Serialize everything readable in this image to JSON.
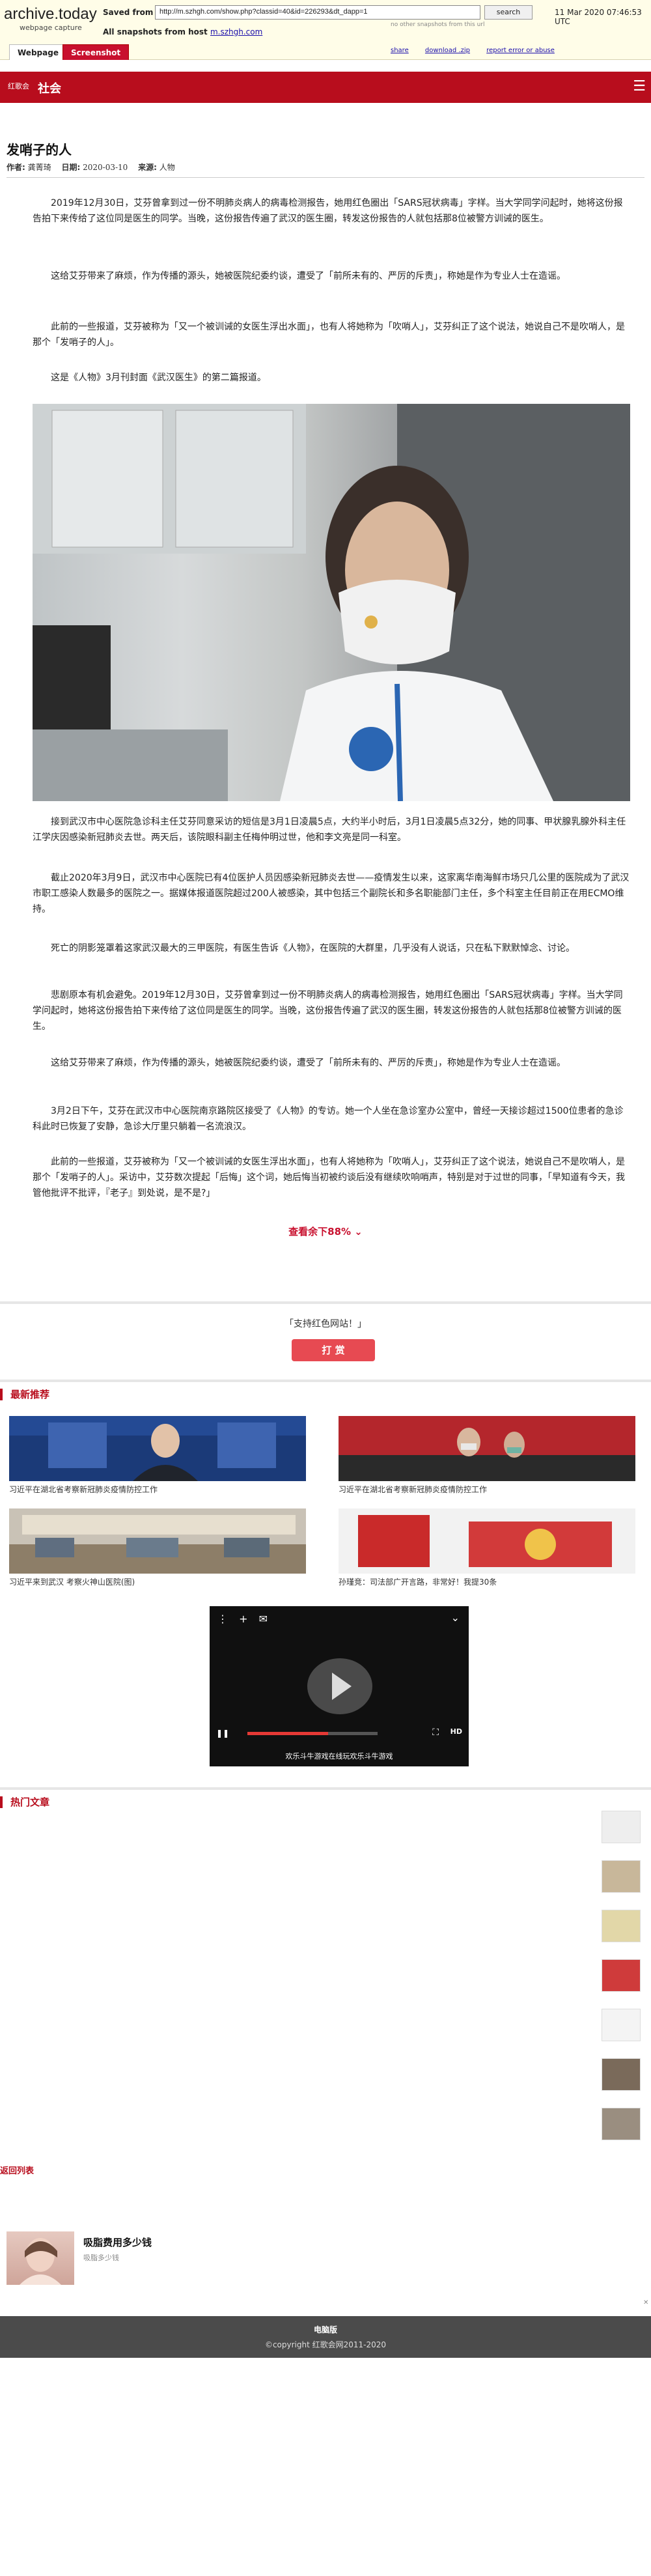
{
  "archive": {
    "logo": "archive.today",
    "logo_sub": "webpage capture",
    "saved_from_label": "Saved from",
    "url": "http://m.szhgh.com/show.php?classid=40&id=226293&dt_dapp=1",
    "search_label": "search",
    "date": "11 Mar 2020 07:46:53 UTC",
    "other_snapshots": "no other snapshots from this url",
    "all_snapshots_label": "All snapshots",
    "from_host_label": "from host",
    "host": "m.szhgh.com",
    "tabs": [
      "Webpage",
      "Screenshot"
    ],
    "links": [
      "share",
      "download .zip",
      "report error or abuse"
    ]
  },
  "site": {
    "logo": "红歌会",
    "section": "社会",
    "menu_icon": "hamburger-icon"
  },
  "article": {
    "title": "发哨子的人",
    "author_label": "作者:",
    "author": "龚菁琦",
    "date_label": "日期:",
    "date": "2020-03-10",
    "source_label": "来源:",
    "source": "人物",
    "paragraphs_top": [
      "2019年12月30日，艾芬曾拿到过一份不明肺炎病人的病毒检测报告，她用红色圈出「SARS冠状病毒」字样。当大学同学问起时，她将这份报告拍下来传给了这位同是医生的同学。当晚，这份报告传遍了武汉的医生圈，转发这份报告的人就包括那8位被警方训诫的医生。",
      "这给艾芬带来了麻烦，作为传播的源头，她被医院纪委约谈，遭受了「前所未有的、严厉的斥责」，称她是作为专业人士在造谣。",
      "此前的一些报道，艾芬被称为「又一个被训诫的女医生浮出水面」，也有人将她称为「吹哨人」，艾芬纠正了这个说法，她说自己不是吹哨人，是那个「发哨子的人」。",
      "这是《人物》3月刊封面《武汉医生》的第二篇报道。"
    ],
    "paragraphs_bottom": [
      "接到武汉市中心医院急诊科主任艾芬同意采访的短信是3月1日凌晨5点，大约半小时后，3月1日凌晨5点32分，她的同事、甲状腺乳腺外科主任江学庆因感染新冠肺炎去世。两天后，该院眼科副主任梅仲明过世，他和李文亮是同一科室。",
      "截止2020年3月9日，武汉市中心医院已有4位医护人员因感染新冠肺炎去世——疫情发生以来，这家离华南海鲜市场只几公里的医院成为了武汉市职工感染人数最多的医院之一。据媒体报道医院超过200人被感染，其中包括三个副院长和多名职能部门主任，多个科室主任目前正在用ECMO维持。",
      "死亡的阴影笼罩着这家武汉最大的三甲医院，有医生告诉《人物》，在医院的大群里，几乎没有人说话，只在私下默默悼念、讨论。",
      "悲剧原本有机会避免。2019年12月30日，艾芬曾拿到过一份不明肺炎病人的病毒检测报告，她用红色圈出「SARS冠状病毒」字样。当大学同学问起时，她将这份报告拍下来传给了这位同是医生的同学。当晚，这份报告传遍了武汉的医生圈，转发这份报告的人就包括那8位被警方训诫的医生。",
      "这给艾芬带来了麻烦，作为传播的源头，她被医院纪委约谈，遭受了「前所未有的、严厉的斥责」，称她是作为专业人士在造谣。",
      "3月2日下午，艾芬在武汉市中心医院南京路院区接受了《人物》的专访。她一个人坐在急诊室办公室中，曾经一天接诊超过1500位患者的急诊科此时已恢复了安静，急诊大厅里只躺着一名流浪汉。",
      "此前的一些报道，艾芬被称为「又一个被训诫的女医生浮出水面」，也有人将她称为「吹哨人」，艾芬纠正了这个说法，她说自己不是吹哨人，是那个「发哨子的人」。采访中，艾芬数次提起「后悔」这个词，她后悔当初被约谈后没有继续吹响哨声，特别是对于过世的同事，「早知道有今天，我管他批评不批评，『老子』到处说，是不是?」"
    ],
    "read_more": "查看余下88%"
  },
  "support": {
    "text": "「支持红色网站！」",
    "reward_label": "打 赏"
  },
  "recommend": {
    "heading": "最新推荐",
    "items": [
      {
        "caption": "习近平在湖北省考察新冠肺炎疫情防控工作"
      },
      {
        "caption": "习近平在湖北省考察新冠肺炎疫情防控工作"
      },
      {
        "caption": "习近平来到武汉 考察火神山医院(图)"
      },
      {
        "caption": "孙瑾竞：司法部广开言路，非常好！我提30条"
      }
    ]
  },
  "video": {
    "caption": "欢乐斗牛游戏在线玩欢乐斗牛游戏",
    "progress": 0.62,
    "hd_label": "HD"
  },
  "hot": {
    "heading": "热门文章"
  },
  "back_list": "返回列表",
  "ad": {
    "title": "吸脂费用多少钱",
    "subtitle": "吸脂多少钱"
  },
  "footer": {
    "pc_version": "电脑版",
    "copyright": "©copyright 红歌会网2011-2020"
  }
}
